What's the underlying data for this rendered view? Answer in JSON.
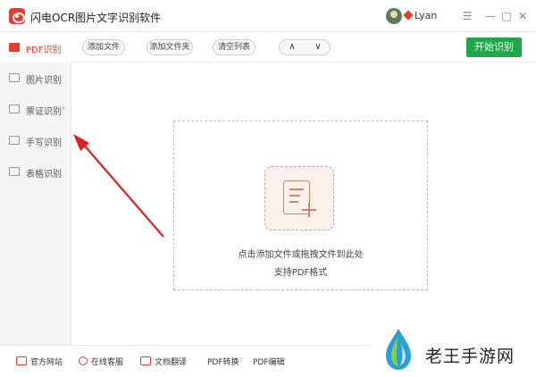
{
  "app": {
    "title": "闪电OCR图片文字识别软件",
    "user": "Lyan",
    "window_buttons": {
      "menu": "☰",
      "minimize": "—",
      "maximize": "□",
      "close": "✕"
    }
  },
  "sidebar": {
    "items": [
      {
        "label": "PDF识别",
        "icon": "pdf-icon"
      },
      {
        "label": "图片识别",
        "icon": "image-icon"
      },
      {
        "label": "票证识别",
        "icon": "ticket-icon"
      },
      {
        "label": "手写识别",
        "icon": "handwriting-icon"
      },
      {
        "label": "表格识别",
        "icon": "table-icon"
      }
    ],
    "chevron": "›"
  },
  "toolbar": {
    "add_file": "添加文件",
    "add_folder": "添加文件夹",
    "clear_list": "清空列表",
    "up": "∧",
    "down": "∨",
    "start": "开始识别"
  },
  "dropzone": {
    "hint": "点击添加文件或拖拽文件到此处",
    "formats": "支持PDF格式"
  },
  "footer": {
    "items": [
      {
        "label": "官方网站",
        "icon": "monitor-icon"
      },
      {
        "label": "在线客服",
        "icon": "headset-icon"
      },
      {
        "label": "文档翻译",
        "icon": "translate-icon"
      },
      {
        "label": "PDF转换",
        "icon": ""
      },
      {
        "label": "PDF编辑",
        "icon": ""
      }
    ]
  },
  "overlay": {
    "site_name": "老王手游网"
  },
  "colors": {
    "accent": "#e63b2e",
    "start_button": "#1fa84a",
    "drop_icon": "#c9866c"
  }
}
